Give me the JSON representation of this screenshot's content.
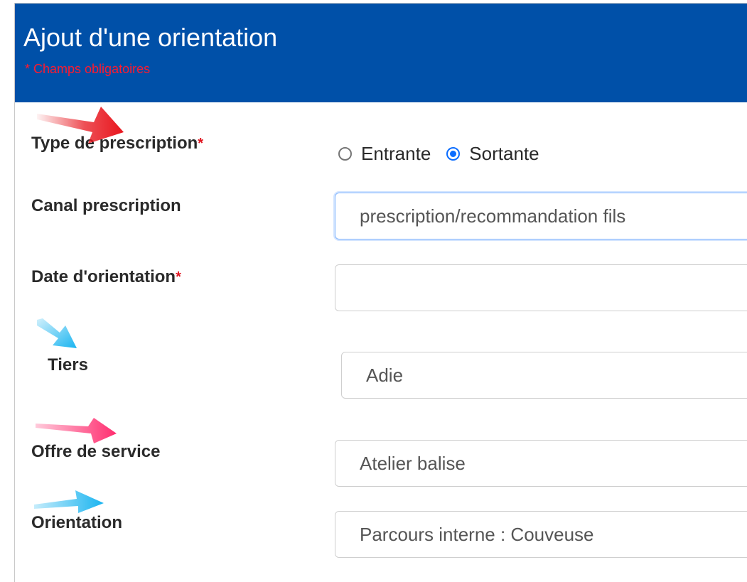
{
  "header": {
    "title": "Ajout d'une orientation",
    "required_note": "* Champs obligatoires"
  },
  "form": {
    "type_prescription": {
      "label": "Type de prescription",
      "required_mark": "*",
      "options": [
        "Entrante",
        "Sortante"
      ],
      "selected": "Sortante"
    },
    "canal_prescription": {
      "label": "Canal prescription",
      "value": "prescription/recommandation fils"
    },
    "date_orientation": {
      "label": "Date d'orientation",
      "required_mark": "*",
      "value": ""
    },
    "tiers": {
      "label": "Tiers",
      "value": "Adie"
    },
    "offre_service": {
      "label": "Offre de service",
      "value": "Atelier balise"
    },
    "orientation": {
      "label": "Orientation",
      "value": "Parcours interne : Couveuse"
    }
  },
  "colors": {
    "header_bg": "#0050a8",
    "required_red": "#e0141f",
    "radio_blue": "#0b6dff",
    "annotation_red": "#e8151d",
    "annotation_pink": "#ff2d6f",
    "annotation_cyan": "#19b4f0"
  },
  "annotations": [
    {
      "name": "red-arrow-icon",
      "points_to": "Type de prescription"
    },
    {
      "name": "cyan-arrow-icon",
      "points_to": "Tiers"
    },
    {
      "name": "pink-arrow-icon",
      "points_to": "Offre de service"
    },
    {
      "name": "cyan-arrow-icon",
      "points_to": "Orientation"
    }
  ]
}
